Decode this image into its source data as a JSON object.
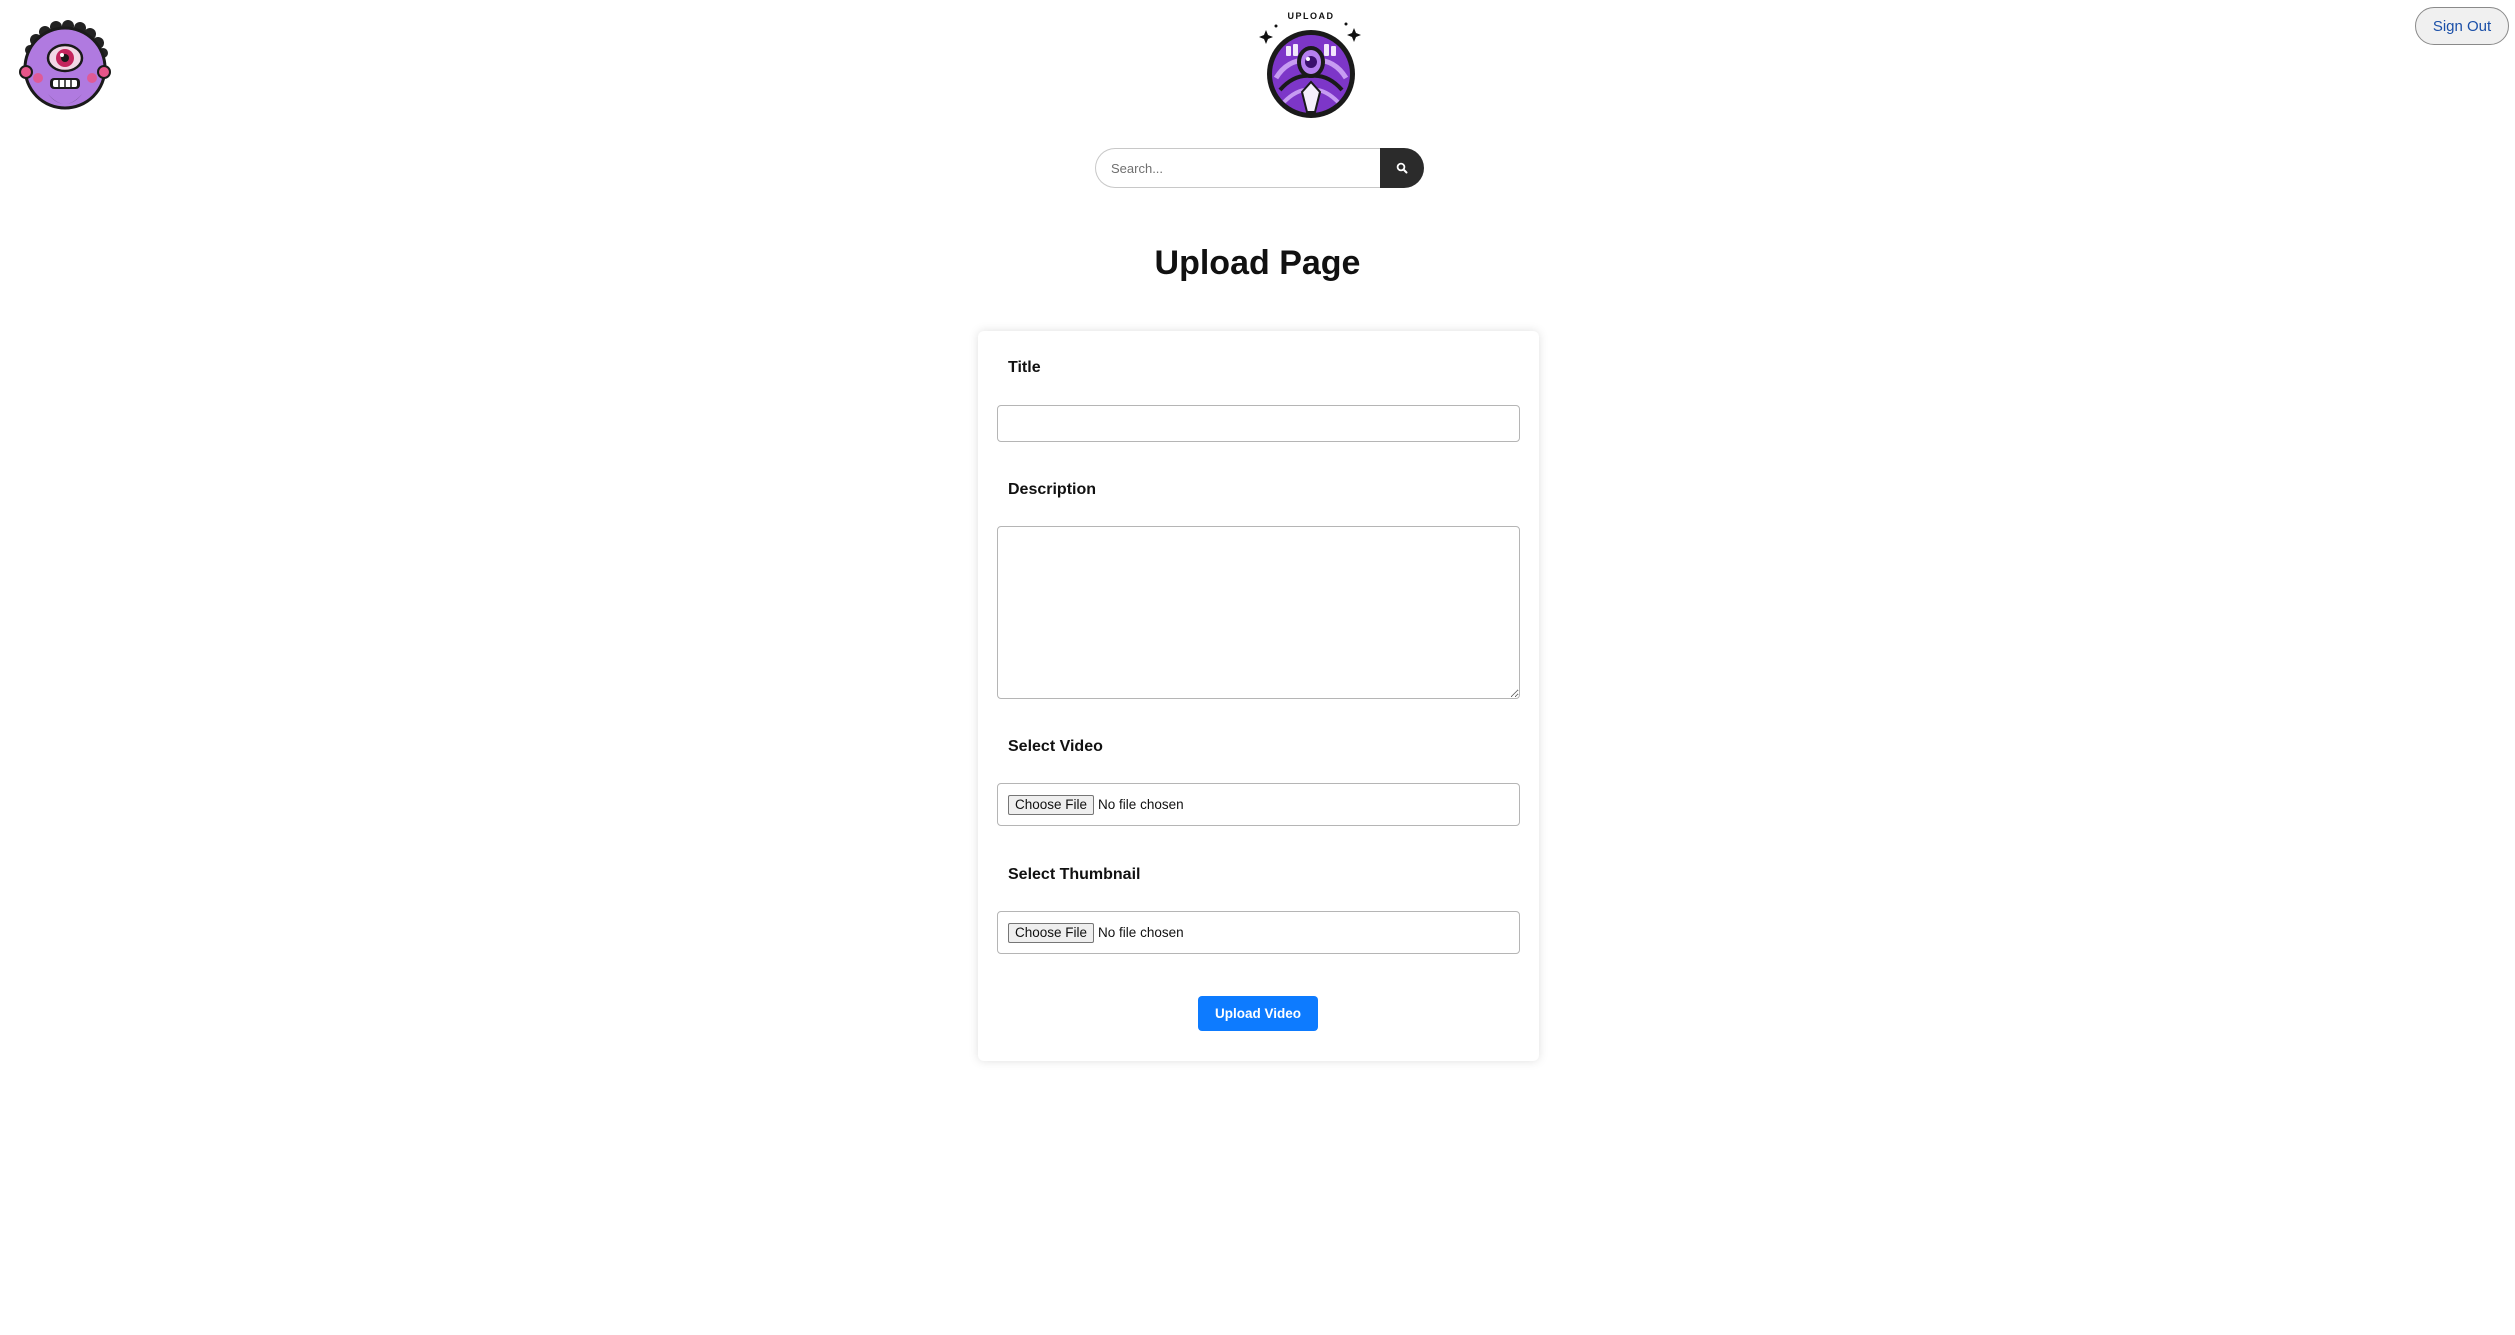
{
  "header": {
    "logo_caption": "UPLOAD",
    "sign_out_label": "Sign Out"
  },
  "search": {
    "placeholder": "Search...",
    "button_icon": "search-icon"
  },
  "main": {
    "title": "Upload Page"
  },
  "form": {
    "title_label": "Title",
    "title_value": "",
    "description_label": "Description",
    "description_value": "",
    "video_label": "Select Video",
    "video_button": "Choose File",
    "video_status": "No file chosen",
    "thumbnail_label": "Select Thumbnail",
    "thumbnail_button": "Choose File",
    "thumbnail_status": "No file chosen",
    "submit_label": "Upload Video"
  },
  "colors": {
    "accent": "#0d7bff",
    "search_button": "#2b2b2b",
    "logo_purple": "#8a3fd6",
    "avatar_purple": "#b07ae0",
    "sign_out_text": "#1a4fa8"
  }
}
